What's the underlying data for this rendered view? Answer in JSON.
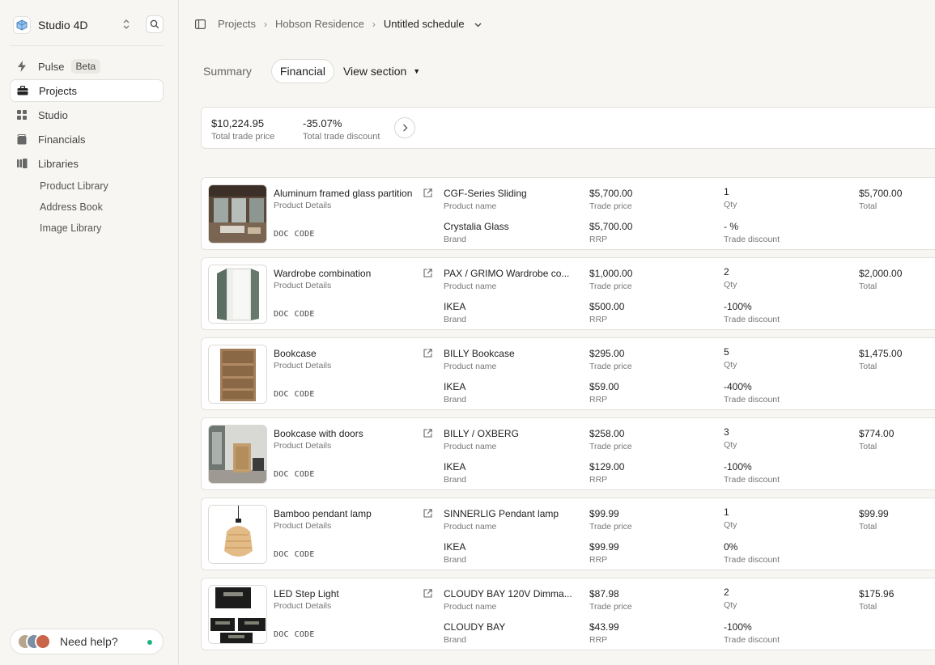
{
  "workspace": {
    "name": "Studio 4D"
  },
  "nav": [
    {
      "label": "Pulse",
      "badge": "Beta",
      "icon": "bolt-icon"
    },
    {
      "label": "Projects",
      "icon": "briefcase-icon",
      "active": true
    },
    {
      "label": "Studio",
      "icon": "grid-icon"
    },
    {
      "label": "Financials",
      "icon": "wallet-icon"
    },
    {
      "label": "Libraries",
      "icon": "library-icon"
    }
  ],
  "libraries": [
    "Product Library",
    "Address Book",
    "Image Library"
  ],
  "help": {
    "label": "Need help?",
    "status_color": "#1db386"
  },
  "breadcrumb": [
    "Projects",
    "Hobson Residence",
    "Untitled schedule"
  ],
  "tabs": {
    "summary": "Summary",
    "financial": "Financial",
    "view_section": "View section"
  },
  "summary": {
    "total_trade_price": "$10,224.95",
    "total_trade_price_label": "Total trade price",
    "total_trade_discount": "-35.07%",
    "total_trade_discount_label": "Total trade discount"
  },
  "labels": {
    "product_details": "Product Details",
    "doc": "DOC",
    "code": "CODE",
    "product_name": "Product name",
    "brand": "Brand",
    "trade_price": "Trade price",
    "rrp": "RRP",
    "qty": "Qty",
    "trade_discount": "Trade discount",
    "total": "Total"
  },
  "items": [
    {
      "title": "Aluminum framed glass partition",
      "product_name": "CGF-Series Sliding",
      "brand": "Crystalia Glass",
      "trade_price": "$5,700.00",
      "rrp": "$5,700.00",
      "qty": "1",
      "discount": "- %",
      "total": "$5,700.00",
      "thumb": "interior"
    },
    {
      "title": "Wardrobe combination",
      "product_name": "PAX / GRIMO Wardrobe co...",
      "brand": "IKEA",
      "trade_price": "$1,000.00",
      "rrp": "$500.00",
      "qty": "2",
      "discount": "-100%",
      "total": "$2,000.00",
      "thumb": "wardrobe"
    },
    {
      "title": "Bookcase",
      "product_name": "BILLY Bookcase",
      "brand": "IKEA",
      "trade_price": "$295.00",
      "rrp": "$59.00",
      "qty": "5",
      "discount": "-400%",
      "total": "$1,475.00",
      "thumb": "bookcase"
    },
    {
      "title": "Bookcase with doors",
      "product_name": "BILLY / OXBERG",
      "brand": "IKEA",
      "trade_price": "$258.00",
      "rrp": "$129.00",
      "qty": "3",
      "discount": "-100%",
      "total": "$774.00",
      "thumb": "room"
    },
    {
      "title": "Bamboo pendant lamp",
      "product_name": "SINNERLIG Pendant lamp",
      "brand": "IKEA",
      "trade_price": "$99.99",
      "rrp": "$99.99",
      "qty": "1",
      "discount": "0%",
      "total": "$99.99",
      "thumb": "lamp"
    },
    {
      "title": "LED Step Light",
      "product_name": "CLOUDY BAY 120V Dimma...",
      "brand": "CLOUDY BAY",
      "trade_price": "$87.98",
      "rrp": "$43.99",
      "qty": "2",
      "discount": "-100%",
      "total": "$175.96",
      "thumb": "steplight"
    }
  ]
}
